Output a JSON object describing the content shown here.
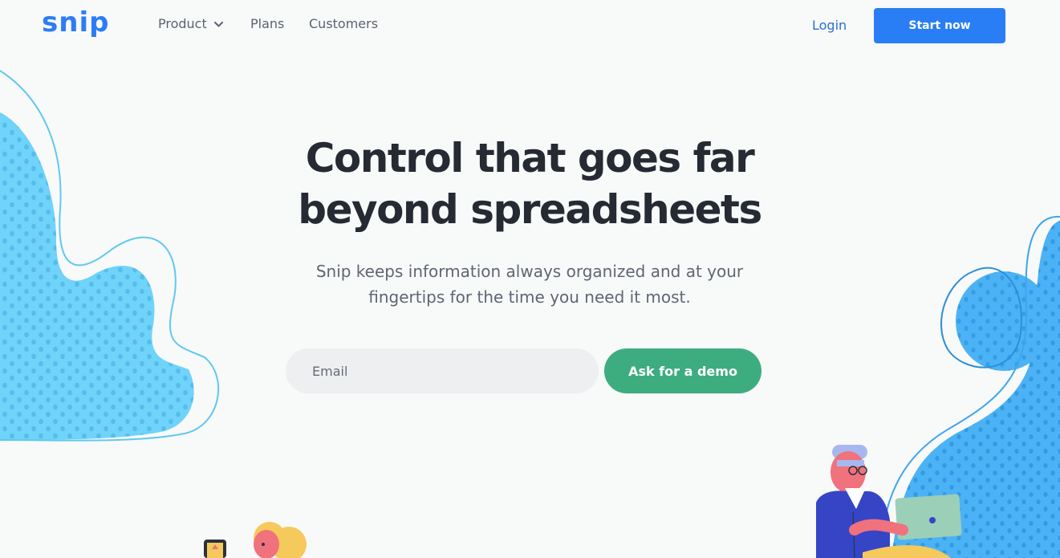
{
  "brand": {
    "logo_text": "snip",
    "accent_color": "#2a7ef5"
  },
  "nav": {
    "items": [
      {
        "label": "Product",
        "icon": "chevron-down-icon"
      },
      {
        "label": "Plans"
      },
      {
        "label": "Customers"
      }
    ]
  },
  "header_actions": {
    "login_label": "Login",
    "start_label": "Start now"
  },
  "hero": {
    "title_line1": "Control that goes far",
    "title_line2": "beyond spreadsheets",
    "subtitle_line1": "Snip keeps information always organized and at your",
    "subtitle_line2": "fingertips for the time you need it most."
  },
  "signup": {
    "email_placeholder": "Email",
    "demo_button_label": "Ask for a demo",
    "demo_button_color": "#3dad80"
  }
}
